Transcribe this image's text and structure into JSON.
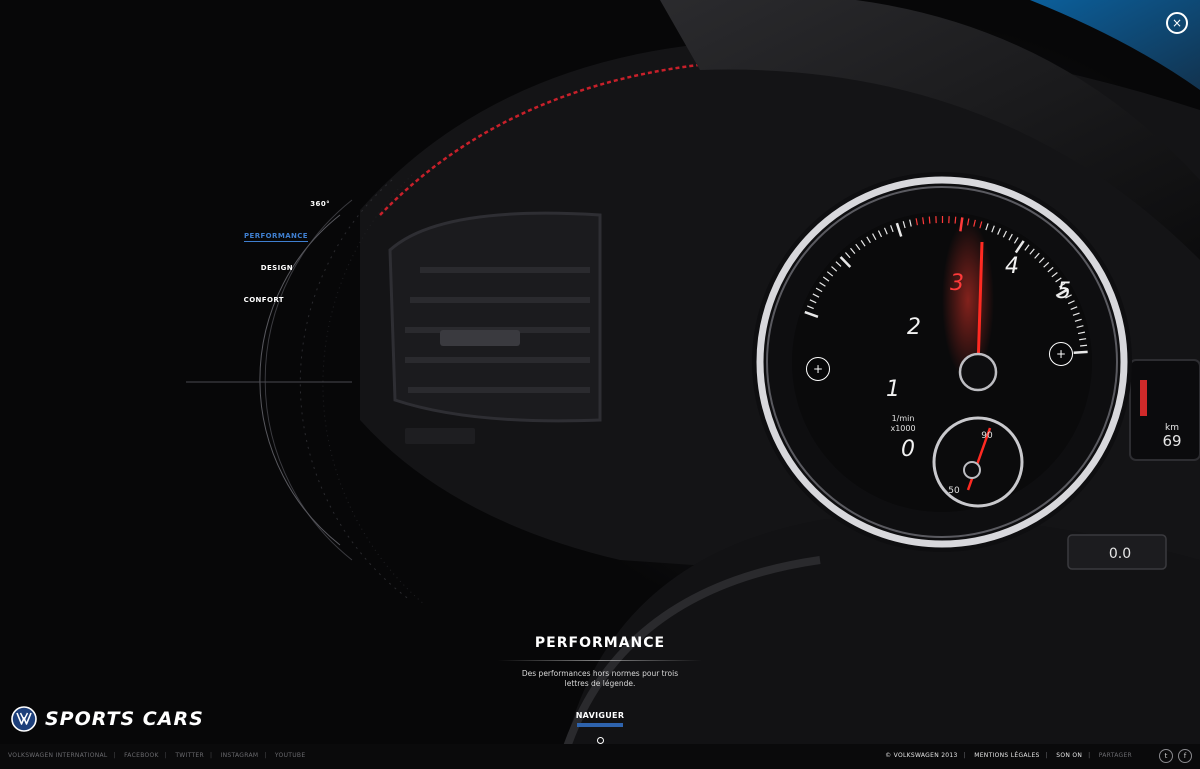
{
  "close": {
    "symbol": "×"
  },
  "side_nav": {
    "items": [
      {
        "label": "360°",
        "active": false
      },
      {
        "label": "PERFORMANCE",
        "active": true
      },
      {
        "label": "DESIGN",
        "active": false
      },
      {
        "label": "CONFORT",
        "active": false
      }
    ]
  },
  "gauge": {
    "numbers": [
      "0",
      "1",
      "2",
      "3",
      "4",
      "5"
    ],
    "unit_line1": "1/min",
    "unit_line2": "x1000",
    "small_top": "90",
    "small_bottom": "50",
    "odometer": "0.0",
    "km_label": "km",
    "km_value": "69"
  },
  "hotspots": {
    "left_symbol": "+",
    "right_symbol": "+"
  },
  "section": {
    "title": "PERFORMANCE",
    "description": "Des performances hors normes pour trois lettres de légende."
  },
  "naviguer": {
    "label": "NAVIGUER"
  },
  "brand": {
    "logo_icon": "vw-logo-icon",
    "name": "SPORTS CARS"
  },
  "footer": {
    "left_links": [
      "VOLKSWAGEN INTERNATIONAL",
      "FACEBOOK",
      "TWITTER",
      "INSTAGRAM",
      "YOUTUBE"
    ],
    "copyright": "© VOLKSWAGEN 2013",
    "legal": "MENTIONS LÉGALES",
    "sound": "SON ON",
    "share": "PARTAGER",
    "twitter_icon": "twitter-icon",
    "facebook_icon": "facebook-icon",
    "twitter_glyph": "t",
    "facebook_glyph": "f"
  },
  "colors": {
    "accent": "#2e63ad",
    "active_nav": "#3f7fd0",
    "needle": "#e8262a",
    "stitch": "#c8202a"
  }
}
